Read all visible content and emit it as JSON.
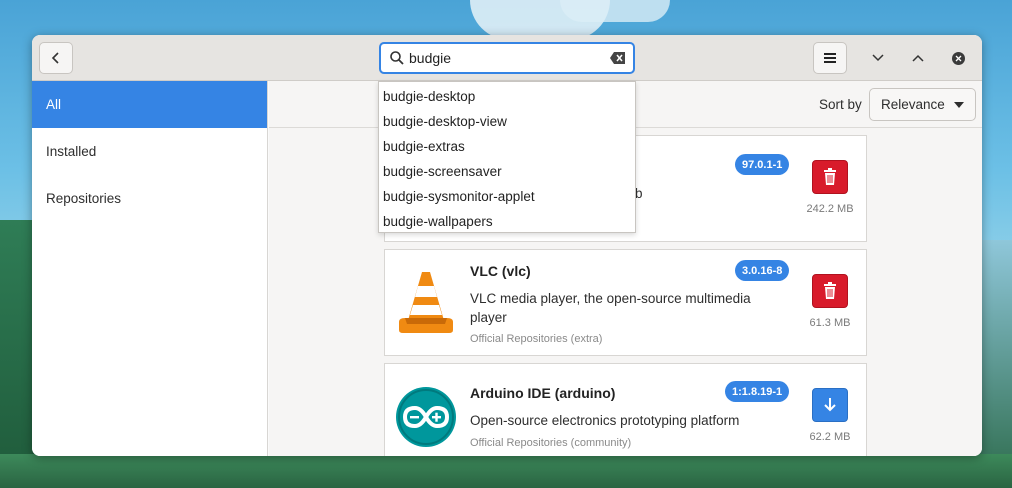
{
  "search": {
    "value": "budgie",
    "suggestions": [
      "budgie-desktop",
      "budgie-desktop-view",
      "budgie-extras",
      "budgie-screensaver",
      "budgie-sysmonitor-applet",
      "budgie-wallpapers"
    ]
  },
  "sidebar": {
    "items": [
      {
        "label": "All",
        "active": true
      },
      {
        "label": "Installed",
        "active": false
      },
      {
        "label": "Repositories",
        "active": false
      }
    ]
  },
  "toolbar": {
    "sort_label": "Sort by",
    "sort_value": "Relevance"
  },
  "apps": [
    {
      "name": "",
      "desc_fragment": "b",
      "version": "97.0.1-1",
      "size": "242.2 MB",
      "action": "remove",
      "icon": "app-icon-hidden"
    },
    {
      "name": "VLC (vlc)",
      "desc": "VLC media player, the open-source multimedia player",
      "repo": "Official Repositories (extra)",
      "version": "3.0.16-8",
      "size": "61.3 MB",
      "action": "remove",
      "icon": "vlc-cone-icon"
    },
    {
      "name": "Arduino IDE (arduino)",
      "desc": "Open-source electronics prototyping platform",
      "repo": "Official Repositories (community)",
      "version": "1:1.8.19-1",
      "size": "62.2 MB",
      "action": "install",
      "icon": "arduino-icon"
    }
  ],
  "colors": {
    "accent": "#3584e4",
    "remove": "#d81b2b"
  }
}
